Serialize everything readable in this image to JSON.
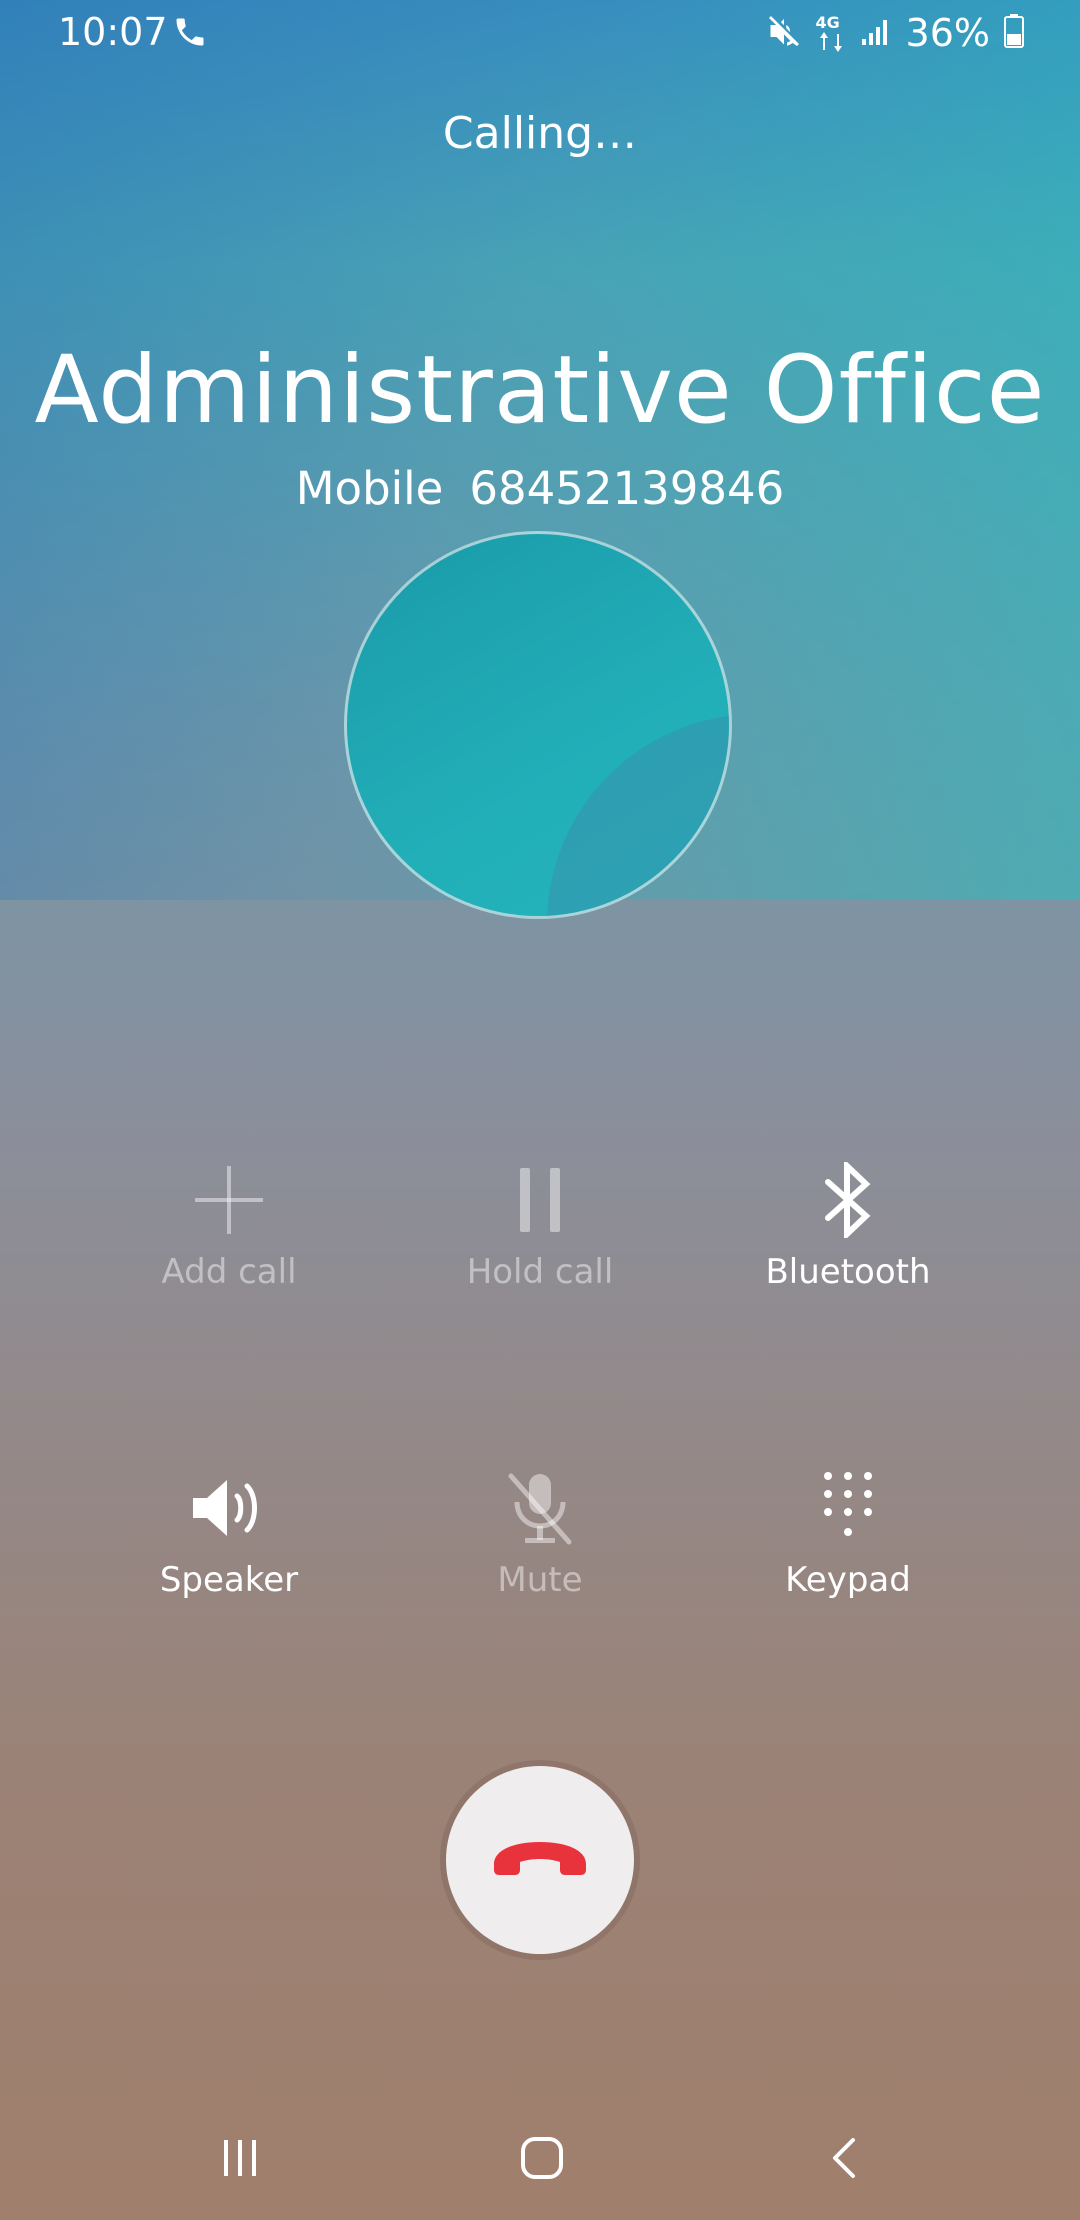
{
  "status_bar": {
    "time": "10:07",
    "battery_percent": "36%",
    "network_label": "4G",
    "icons": [
      "phone-call-icon",
      "mute-icon",
      "4g-data-icon",
      "signal-icon",
      "battery-icon"
    ],
    "battery_level": 0.36
  },
  "call": {
    "status": "Calling…",
    "contact_name": "Administrative Office",
    "number_type": "Mobile",
    "number": "68452139846"
  },
  "actions": {
    "add_call": {
      "label": "Add call",
      "icon": "plus-icon",
      "enabled": false
    },
    "hold_call": {
      "label": "Hold call",
      "icon": "pause-icon",
      "enabled": false
    },
    "bluetooth": {
      "label": "Bluetooth",
      "icon": "bluetooth-icon",
      "enabled": true
    },
    "speaker": {
      "label": "Speaker",
      "icon": "speaker-icon",
      "enabled": true
    },
    "mute": {
      "label": "Mute",
      "icon": "mic-off-icon",
      "enabled": false
    },
    "keypad": {
      "label": "Keypad",
      "icon": "dialpad-icon",
      "enabled": true
    }
  },
  "end_call": {
    "icon": "end-call-icon"
  },
  "nav_bar": {
    "icons": [
      "recent-apps-icon",
      "home-icon",
      "back-icon"
    ]
  },
  "colors": {
    "end_call_red": "#e8333c",
    "text": "#ffffff"
  }
}
